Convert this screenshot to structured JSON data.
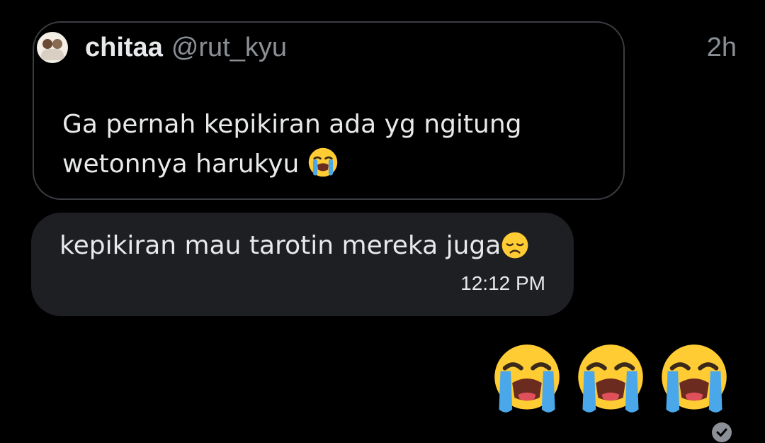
{
  "quote": {
    "display_name": "chitaa",
    "handle": "@rut_kyu",
    "time_ago": "2h",
    "text_line1": "Ga pernah kepikiran ada yg ngitung",
    "text_line2": "wetonnya harukyu",
    "line2_emoji": "loudly-crying-face-emoji"
  },
  "reply": {
    "text": "kepikiran mau tarotin mereka juga",
    "emoji": "disappointed-face-emoji",
    "time": "12:12 PM"
  },
  "big_emojis": [
    "loudly-crying-face-emoji",
    "loudly-crying-face-emoji",
    "loudly-crying-face-emoji"
  ],
  "status_icon": "sent-check-icon",
  "colors": {
    "background": "#000000",
    "bubble": "#1e1f22",
    "card_border": "#3a3d41",
    "text_primary": "#e7e9ea",
    "text_secondary": "#8b9096"
  }
}
